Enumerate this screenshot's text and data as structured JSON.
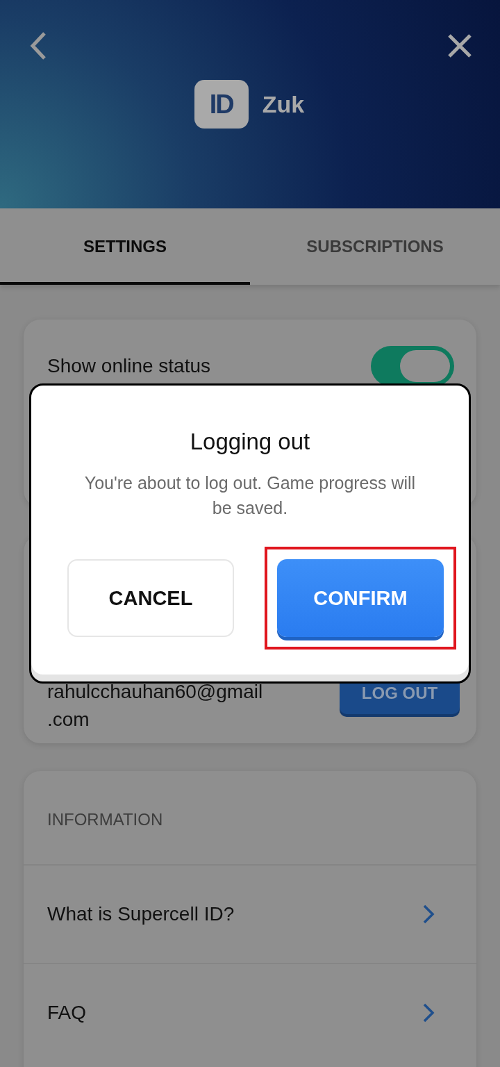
{
  "header": {
    "title": "Zuk",
    "logo_text": "ID"
  },
  "tabs": [
    {
      "label": "SETTINGS",
      "selected": true
    },
    {
      "label": "SUBSCRIPTIONS",
      "selected": false
    }
  ],
  "online_status": {
    "label": "Show online status",
    "on": true
  },
  "account": {
    "email": "rahulcchauhan60@gmail\n.com",
    "button": "LOG OUT"
  },
  "information": {
    "heading": "INFORMATION",
    "items": [
      "What is Supercell ID?",
      "FAQ"
    ]
  },
  "dialog": {
    "title": "Logging out",
    "message": "You're about to log out. Game progress will be saved.",
    "buttons": [
      {
        "label": "CANCEL",
        "kind": "secondary",
        "highlighted": false
      },
      {
        "label": "CONFIRM",
        "kind": "primary",
        "highlighted": true
      }
    ]
  }
}
